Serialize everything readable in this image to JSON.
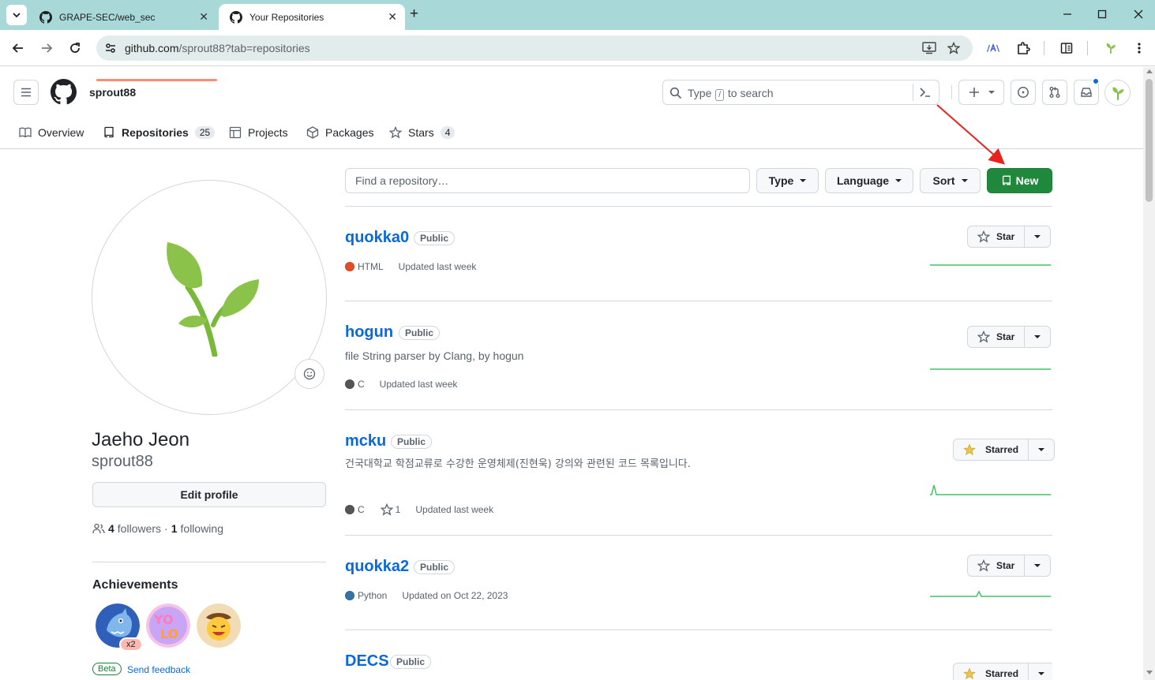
{
  "browser": {
    "tabs": [
      {
        "title": "GRAPE-SEC/web_sec",
        "icon": "github-icon"
      },
      {
        "title": "Your Repositories",
        "icon": "github-icon"
      }
    ],
    "url_host": "github.com",
    "url_path": "/sprout88?tab=repositories"
  },
  "header": {
    "username": "sprout88",
    "search_prefix": "Type",
    "search_key": "/",
    "search_suffix": "to search"
  },
  "profile_tabs": [
    {
      "label": "Overview",
      "count": null
    },
    {
      "label": "Repositories",
      "count": "25"
    },
    {
      "label": "Projects",
      "count": null
    },
    {
      "label": "Packages",
      "count": null
    },
    {
      "label": "Stars",
      "count": "4"
    }
  ],
  "profile": {
    "name": "Jaeho Jeon",
    "login": "sprout88",
    "edit_label": "Edit profile",
    "followers_count": "4",
    "followers_label": "followers",
    "dot": "·",
    "following_count": "1",
    "following_label": "following",
    "achievements_title": "Achievements",
    "achievement_multiplier": "x2",
    "beta_label": "Beta",
    "feedback_label": "Send feedback"
  },
  "filters": {
    "find_placeholder": "Find a repository…",
    "type_label": "Type",
    "language_label": "Language",
    "sort_label": "Sort",
    "new_label": "New"
  },
  "repos": [
    {
      "name": "quokka0",
      "visibility": "Public",
      "description": "",
      "language": "HTML",
      "lang_color": "#e34c26",
      "stars": "",
      "updated": "Updated last week",
      "star_label": "Star",
      "starred": false
    },
    {
      "name": "hogun",
      "visibility": "Public",
      "description": "file String parser by Clang, by hogun",
      "language": "C",
      "lang_color": "#555555",
      "stars": "",
      "updated": "Updated last week",
      "star_label": "Star",
      "starred": false
    },
    {
      "name": "mcku",
      "visibility": "Public",
      "description": "건국대학교 학점교류로 수강한 운영체제(진현욱) 강의와 관련된 코드 목록입니다.",
      "language": "C",
      "lang_color": "#555555",
      "stars": "1",
      "updated": "Updated last week",
      "star_label": "Starred",
      "starred": true
    },
    {
      "name": "quokka2",
      "visibility": "Public",
      "description": "",
      "language": "Python",
      "lang_color": "#3572A5",
      "stars": "",
      "updated": "Updated on Oct 22, 2023",
      "star_label": "Star",
      "starred": false
    },
    {
      "name": "DECS",
      "visibility": "Public",
      "description": "",
      "language": "",
      "lang_color": "",
      "stars": "",
      "updated": "",
      "star_label": "Starred",
      "starred": true
    }
  ],
  "colors": {
    "accent_green": "#1f883d",
    "link_blue": "#0969da",
    "tab_underline": "#fd8c73",
    "annotation_arrow": "#e8231c"
  }
}
